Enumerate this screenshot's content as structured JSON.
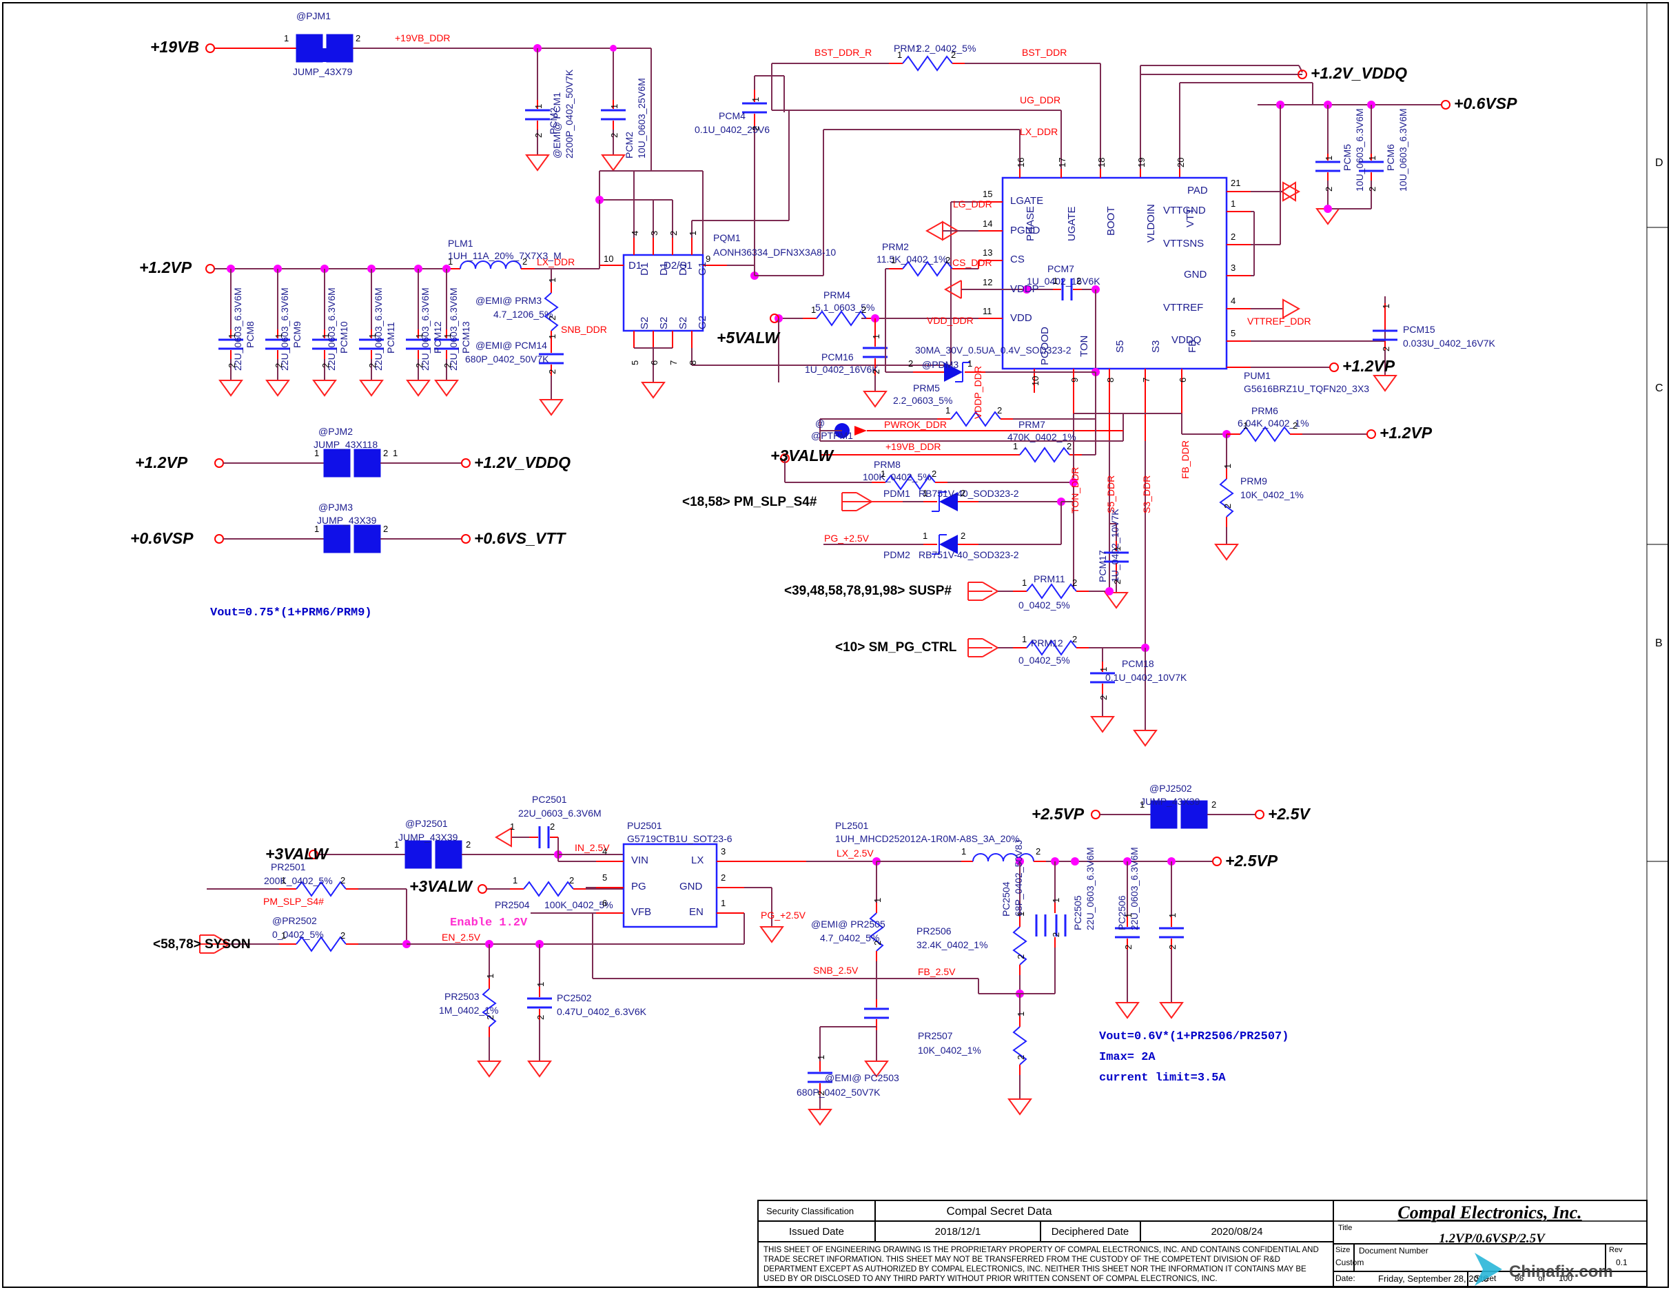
{
  "sheet": {
    "zone_marks": [
      "D",
      "C",
      "B"
    ],
    "notes": {
      "ddr_formula": "Vout=0.75*(1+PRM6/PRM9)",
      "v25_formula_1": "Vout=0.6V*(1+PR2506/PR2507)",
      "v25_formula_2": "Imax=  2A",
      "v25_formula_3": "current limit=3.5A",
      "enable": "Enable 1.2V"
    }
  },
  "rails": {
    "v19vb": "+19VB",
    "v12vp_left": "+1.2VP",
    "v12vp_jm2": "+1.2VP",
    "v06vsp_jm3": "+0.6VSP",
    "v12v_vddq_out": "+1.2V_VDDQ",
    "v06vsp_out": "+0.6VSP",
    "v12vp_vddq_out": "+1.2V_VDDQ",
    "v06vs_vtt_out": "+0.6VS_VTT",
    "v12vp_r1": "+1.2VP",
    "v12vp_r2": "+1.2VP",
    "v5valw": "+5VALW",
    "v3valw_mid": "+3VALW",
    "v3valw_bot": "+3VALW",
    "v3valw_bot2": "+3VALW",
    "v25vp_top": "+2.5VP",
    "v25v_out": "+2.5V",
    "v25vp_out": "+2.5VP"
  },
  "nets": {
    "v19vb_ddr": "+19VB_DDR",
    "bst_ddr_r": "BST_DDR_R",
    "bst_ddr": "BST_DDR",
    "ug_ddr": "UG_DDR",
    "lx_ddr_top": "LX_DDR",
    "lg_ddr": "LG_DDR",
    "cs_ddr": "CS_DDR",
    "vdd_ddr": "VDD_DDR",
    "vddp_ddr": "VDDP_DDR",
    "pwrok_ddr": "PWROK_DDR",
    "v19vb_ddr2": "+19VB_DDR",
    "ton_ddr": "TON_DDR",
    "s5_ddr": "S5_DDR",
    "s3_ddr": "S3_DDR",
    "fb_ddr": "FB_DDR",
    "vttref_ddr": "VTTREF_DDR",
    "lx_ddr_ind": "LX_DDR",
    "snb_ddr": "SNB_DDR",
    "pg_25v": "PG_+2.5V",
    "pg_25v_b": "PG_+2.5V",
    "pm_slp_s4_b": "PM_SLP_S4#",
    "in_25v": "IN_2.5V",
    "lx_25v": "LX_2.5V",
    "en_25v": "EN_2.5V",
    "snb_25v": "SNB_2.5V",
    "fb_25v": "FB_2.5V"
  },
  "ports": {
    "pm_slp_s4": "<18,58>  PM_SLP_S4#",
    "susp": "<39,48,58,78,91,98>  SUSP#",
    "sm_pg_ctrl": "<10>  SM_PG_CTRL",
    "syson": "<58,78>  SYSON"
  },
  "components": [
    {
      "ref": "@PJM1",
      "val": "JUMP_43X79"
    },
    {
      "ref": "@EMI@   PCM1",
      "val": "2200P_0402_50V7K"
    },
    {
      "ref": "PCM2",
      "val": "10U_0603_25V6M"
    },
    {
      "ref": "PCM4",
      "val": "0.1U_0402_25V6"
    },
    {
      "ref": "PRM1",
      "val": "2.2_0402_5%"
    },
    {
      "ref": "PQM1",
      "val": "AONH36334_DFN3X3A8-10"
    },
    {
      "ref": "PLM1",
      "val": "1UH_11A_20%_7X7X3_M"
    },
    {
      "ref": "@EMI@   PRM3",
      "val": "4.7_1206_5%"
    },
    {
      "ref": "@EMI@   PCM14",
      "val": "680P_0402_50V7K"
    },
    {
      "ref": "PCM8",
      "val": "22U_0603_6.3V6M"
    },
    {
      "ref": "PCM9",
      "val": "22U_0603_6.3V6M"
    },
    {
      "ref": "PCM10",
      "val": "22U_0603_6.3V6M"
    },
    {
      "ref": "PCM11",
      "val": "22U_0603_6.3V6M"
    },
    {
      "ref": "PCM12",
      "val": "22U_0603_6.3V6M"
    },
    {
      "ref": "PCM13",
      "val": "22U_0603_6.3V6M"
    },
    {
      "ref": "PRM2",
      "val": "11.5K_0402_1%"
    },
    {
      "ref": "PCM7",
      "val": "1U_0402_16V6K"
    },
    {
      "ref": "PRM4",
      "val": "5.1_0603_5%"
    },
    {
      "ref": "PCM16",
      "val": "1U_0402_16V6K"
    },
    {
      "ref": "@PDM3",
      "val": "30MA_30V_0.5UA_0.4V_SOD323-2"
    },
    {
      "ref": "PRM5",
      "val": "2.2_0603_5%"
    },
    {
      "ref": "@PTPM1",
      "val": ""
    },
    {
      "ref": "PRM7",
      "val": "470K_0402_1%"
    },
    {
      "ref": "PRM8",
      "val": "100K_0402_5%"
    },
    {
      "ref": "PDM1",
      "val": "RB751V-40_SOD323-2"
    },
    {
      "ref": "PDM2",
      "val": "RB751V-40_SOD323-2"
    },
    {
      "ref": "PCM17",
      "val": "1U_0402_10V7K"
    },
    {
      "ref": "PRM11",
      "val": "0_0402_5%"
    },
    {
      "ref": "PRM12",
      "val": "0_0402_5%"
    },
    {
      "ref": "PCM18",
      "val": "0.1U_0402_10V7K"
    },
    {
      "ref": "PUM1",
      "val": "G5616BRZ1U_TQFN20_3X3"
    },
    {
      "ref": "PCM5",
      "val": "10U_0603_6.3V6M"
    },
    {
      "ref": "PCM6",
      "val": "10U_0603_6.3V6M"
    },
    {
      "ref": "PCM15",
      "val": "0.033U_0402_16V7K"
    },
    {
      "ref": "PRM6",
      "val": "6.04K_0402_1%"
    },
    {
      "ref": "PRM9",
      "val": "10K_0402_1%"
    },
    {
      "ref": "@PJM2",
      "val": "JUMP_43X118"
    },
    {
      "ref": "@PJM3",
      "val": "JUMP_43X39"
    },
    {
      "ref": "@PJ2501",
      "val": "JUMP_43X39"
    },
    {
      "ref": "PC2501",
      "val": "22U_0603_6.3V6M"
    },
    {
      "ref": "PR2501",
      "val": "200K_0402_5%"
    },
    {
      "ref": "@PR2502",
      "val": "0_0402_5%"
    },
    {
      "ref": "PR2503",
      "val": "1M_0402_1%"
    },
    {
      "ref": "PC2502",
      "val": "0.47U_0402_6.3V6K"
    },
    {
      "ref": "PR2504",
      "val": "100K_0402_5%"
    },
    {
      "ref": "PU2501",
      "val": "G5719CTB1U_SOT23-6"
    },
    {
      "ref": "PL2501",
      "val": "1UH_MHCD252012A-1R0M-A8S_3A_20%"
    },
    {
      "ref": "@EMI@   PR2505",
      "val": "4.7_0402_5%"
    },
    {
      "ref": "@EMI@   PC2503",
      "val": "680P_0402_50V7K"
    },
    {
      "ref": "PR2506",
      "val": "32.4K_0402_1%"
    },
    {
      "ref": "PR2507",
      "val": "10K_0402_1%"
    },
    {
      "ref": "PC2504",
      "val": "68P_0402_50V8J"
    },
    {
      "ref": "PC2505",
      "val": "22U_0603_6.3V6M"
    },
    {
      "ref": "PC2506",
      "val": "22U_0603_6.3V6M"
    },
    {
      "ref": "@PJ2502",
      "val": "JUMP_43X39"
    }
  ],
  "ics": {
    "pqm1": {
      "ref": "PQM1",
      "part": "AONH36334_DFN3X3A8-10",
      "top_pins": [
        {
          "num": "4",
          "name": "D1"
        },
        {
          "num": "3",
          "name": "D1"
        },
        {
          "num": "2",
          "name": "D1"
        },
        {
          "num": "1",
          "name": "G1"
        }
      ],
      "bottom_pins": [
        {
          "num": "5",
          "name": "S2"
        },
        {
          "num": "6",
          "name": "S2"
        },
        {
          "num": "7",
          "name": "S2"
        },
        {
          "num": "8",
          "name": "G2"
        }
      ],
      "left_pins": [
        {
          "num": "10",
          "name": "D1"
        }
      ],
      "right_pins": [
        {
          "num": "9",
          "name": "D2/S1"
        }
      ]
    },
    "pum1": {
      "ref": "PUM1",
      "part": "G5616BRZ1U_TQFN20_3X3",
      "top_pins": [
        {
          "num": "16",
          "name": "PHASE"
        },
        {
          "num": "17",
          "name": "UGATE"
        },
        {
          "num": "18",
          "name": "BOOT"
        },
        {
          "num": "19",
          "name": "VLDOIN"
        },
        {
          "num": "20",
          "name": "VTT"
        }
      ],
      "left_pins": [
        {
          "num": "15",
          "name": "LGATE"
        },
        {
          "num": "14",
          "name": "PGND"
        },
        {
          "num": "13",
          "name": "CS"
        },
        {
          "num": "12",
          "name": "VDDP"
        },
        {
          "num": "11",
          "name": "VDD"
        }
      ],
      "right_pins": [
        {
          "num": "21",
          "name": "PAD"
        },
        {
          "num": "1",
          "name": "VTTGND"
        },
        {
          "num": "2",
          "name": "VTTSNS"
        },
        {
          "num": "3",
          "name": "GND"
        },
        {
          "num": "4",
          "name": "VTTREF"
        },
        {
          "num": "5",
          "name": "VDDQ"
        }
      ],
      "bottom_pins": [
        {
          "num": "10",
          "name": "PGOOD"
        },
        {
          "num": "9",
          "name": "TON"
        },
        {
          "num": "8",
          "name": "S5"
        },
        {
          "num": "7",
          "name": "S3"
        },
        {
          "num": "6",
          "name": "FB"
        }
      ]
    },
    "pu2501": {
      "ref": "PU2501",
      "part": "G5719CTB1U_SOT23-6",
      "left_pins": [
        {
          "num": "4",
          "name": "VIN"
        },
        {
          "num": "5",
          "name": "PG"
        },
        {
          "num": "6",
          "name": "VFB"
        }
      ],
      "right_pins": [
        {
          "num": "3",
          "name": "LX"
        },
        {
          "num": "2",
          "name": "GND"
        },
        {
          "num": "1",
          "name": "EN"
        }
      ]
    }
  },
  "title_block": {
    "security_classification_label": "Security Classification",
    "security_classification_value": "Compal Secret Data",
    "issued_date_label": "Issued Date",
    "issued_date_value": "2018/12/1",
    "deciphered_date_label": "Deciphered Date",
    "deciphered_date_value": "2020/08/24",
    "disclaimer": "THIS SHEET OF ENGINEERING DRAWING IS THE PROPRIETARY PROPERTY OF COMPAL ELECTRONICS, INC. AND CONTAINS CONFIDENTIAL AND TRADE SECRET INFORMATION. THIS SHEET MAY NOT BE TRANSFERRED FROM THE CUSTODY OF THE COMPETENT DIVISION OF R&D DEPARTMENT EXCEPT AS AUTHORIZED BY COMPAL ELECTRONICS, INC. NEITHER THIS SHEET NOR THE INFORMATION IT CONTAINS MAY BE USED BY OR DISCLOSED TO ANY THIRD PARTY WITHOUT PRIOR WRITTEN CONSENT OF COMPAL ELECTRONICS, INC.",
    "company": "Compal Electronics, Inc.",
    "title_label": "Title",
    "title_value": "1.2VP/0.6VSP/2.5V",
    "size_label": "Size",
    "size_value": "Custom",
    "document_number_label": "Document Number",
    "rev_label": "Rev",
    "rev_value": "0.1",
    "date_label": "Date:",
    "date_value": "Friday, September 28, 2018",
    "sheet_label": "Sheet",
    "sheet_num": "86",
    "sheet_of": "of",
    "sheet_total": "100",
    "watermark": "Chinafix.com"
  }
}
